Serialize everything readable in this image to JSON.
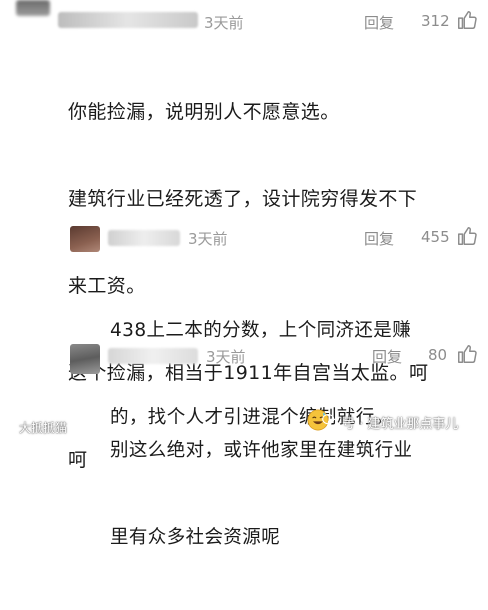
{
  "comments": [
    {
      "time": "3天前",
      "reply_label": "回复",
      "likes": "312",
      "lines": [
        "你能捡漏，说明别人不愿意选。",
        "建筑行业已经死透了，设计院穷得发不下",
        "来工资。",
        "这个捡漏，相当于1911年自宫当太监。呵",
        "呵"
      ]
    },
    {
      "time": "3天前",
      "reply_label": "回复",
      "likes": "455",
      "lines": [
        "438上二本的分数，上个同济还是赚",
        "的，找个人才引进混个编制就行。"
      ]
    },
    {
      "time": "3天前",
      "reply_label": "回复",
      "likes": "80",
      "lines": [
        "别这么绝对，或许他家里在建筑行业",
        "里有众多社会资源呢"
      ]
    }
  ],
  "watermark": {
    "left": "大抵抵猫",
    "right": "号 · 建筑业那点事儿"
  },
  "icons": {
    "thumb": "thumb-up-icon",
    "emoji": "sweat-smile-emoji-icon",
    "wechat": "wechat-logo-icon"
  },
  "colors": {
    "meta_gray": "#9a9a9a",
    "text": "#1b1b1b"
  }
}
